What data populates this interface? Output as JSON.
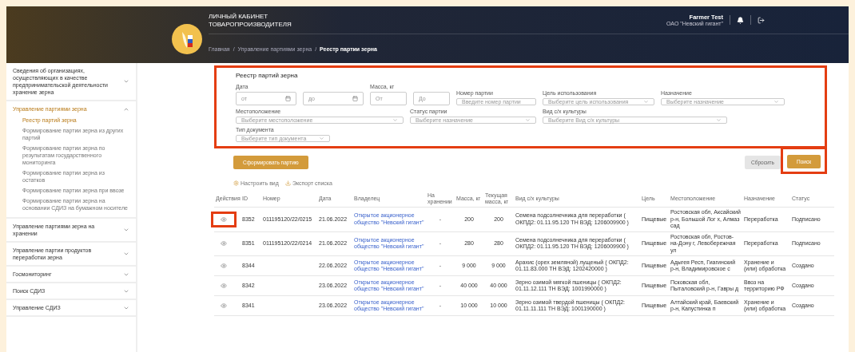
{
  "header": {
    "title_lines": [
      "ЛИЧНЫЙ КАБИНЕТ",
      "ТОВАРОПРОИЗВОДИТЕЛЯ"
    ],
    "breadcrumbs": [
      {
        "label": "Главная",
        "current": false
      },
      {
        "label": "Управление партиями зерна",
        "current": false
      },
      {
        "label": "Реестр партии зерна",
        "current": true
      }
    ],
    "breadcrumb_separator": "/",
    "user": {
      "name": "Farmer Test",
      "org": "ОАО \"Невский гигант\""
    }
  },
  "sidebar": {
    "items": [
      {
        "label": "Сведения об организациях, осуществляющих в качестве предпринимательской деятельности хранение зерна",
        "expanded": false
      },
      {
        "label": "Управление партиями зерна",
        "expanded": true,
        "children": [
          {
            "label": "Реестр партий зерна",
            "selected": true
          },
          {
            "label": "Формирование партии зерна из других партий",
            "selected": false
          },
          {
            "label": "Формирование партии зерна по результатам государственного мониторинга",
            "selected": false
          },
          {
            "label": "Формирование партии зерна из остатков",
            "selected": false
          },
          {
            "label": "Формирование партии зерна при ввозе",
            "selected": false
          },
          {
            "label": "Формирование партии зерна на основании СДИЗ на бумажном носителе",
            "selected": false
          }
        ]
      },
      {
        "label": "Управление партиями зерна на хранении",
        "expanded": false
      },
      {
        "label": "Управление партии продуктов переработки зерна",
        "expanded": false
      },
      {
        "label": "Госмониторинг",
        "expanded": false
      },
      {
        "label": "Поиск СДИЗ",
        "expanded": false
      },
      {
        "label": "Управление СДИЗ",
        "expanded": false
      }
    ]
  },
  "filters": {
    "title": "Реестр партий зерна",
    "highlighted": true,
    "fields": [
      {
        "kind": "date_range",
        "label": "Дата",
        "placeholders": [
          "от",
          "до"
        ]
      },
      {
        "kind": "range",
        "label": "Масса, кг",
        "placeholders": [
          "От",
          "До"
        ]
      },
      {
        "kind": "text",
        "label": "Номер партии",
        "placeholder": "Введите номер партии"
      },
      {
        "kind": "select",
        "label": "Цель использования",
        "placeholder": "Выберите цель использования"
      },
      {
        "kind": "select",
        "label": "Назначение",
        "placeholder": "Выберите назначение"
      },
      {
        "kind": "select",
        "label": "Местоположение",
        "placeholder": "Выберите местоположение"
      },
      {
        "kind": "select",
        "label": "Статус партии",
        "placeholder": "Выберите назначение"
      },
      {
        "kind": "select",
        "label": "Вид с/х культуры",
        "placeholder": "Выберите Вид с/х культуры"
      },
      {
        "kind": "select",
        "label": "Тип документа",
        "placeholder": "Выберите тип документа"
      }
    ]
  },
  "actions": {
    "create": {
      "label": "Сформировать партию"
    },
    "reset": {
      "label": "Сбросить",
      "disabled": true
    },
    "search": {
      "label": "Поиск",
      "highlighted": true
    }
  },
  "toolbar": [
    {
      "kind": "settings",
      "label": "Настроить вид"
    },
    {
      "kind": "export",
      "label": "Экспорт списка"
    }
  ],
  "table": {
    "columns": [
      "Действия",
      "ID",
      "Номер",
      "Дата",
      "Владелец",
      "На хранении",
      "Масса, кг",
      "Текущая масса, кг",
      "Вид с/х культуры",
      "Цель",
      "Местоположение",
      "Назначение",
      "Статус"
    ],
    "rows": [
      {
        "highlighted": true,
        "id": "8352",
        "number": "011195120/22/0215",
        "date": "21.06.2022",
        "owner": "Открытое акционерное общество \"Невский гигант\"",
        "storage": "-",
        "mass": "200",
        "current_mass": "200",
        "crop": "Семена подсолнечника для переработки ( ОКПД2: 01.11.95.120 ТН ВЭД: 1206009900 )",
        "purpose": "Пищевые",
        "location": "Ростовская обл, Аксайский р-н, Большой Лог х, Алмаз сад",
        "assignment": "Переработка",
        "status": "Подписано"
      },
      {
        "highlighted": false,
        "id": "8351",
        "number": "011195120/22/0214",
        "date": "21.06.2022",
        "owner": "Открытое акционерное общество \"Невский гигант\"",
        "storage": "-",
        "mass": "280",
        "current_mass": "280",
        "crop": "Семена подсолнечника для переработки ( ОКПД2: 01.11.95.120 ТН ВЭД: 1206009900 )",
        "purpose": "Пищевые",
        "location": "Ростовская обл, Ростов-на-Дону г, Левобережная ул",
        "assignment": "Переработка",
        "status": "Подписано"
      },
      {
        "highlighted": false,
        "id": "8344",
        "number": "",
        "date": "22.06.2022",
        "owner": "Открытое акционерное общество \"Невский гигант\"",
        "storage": "-",
        "mass": "9 000",
        "current_mass": "9 000",
        "crop": "Арахис (орех земляной) лущеный ( ОКПД2: 01.11.83.000 ТН ВЭД: 1202420000 )",
        "purpose": "Пищевые",
        "location": "Адыгея Респ, Гиагинский р-н, Владимировское с",
        "assignment": "Хранение и (или) обработка",
        "status": "Создано"
      },
      {
        "highlighted": false,
        "id": "8342",
        "number": "",
        "date": "23.06.2022",
        "owner": "Открытое акционерное общество \"Невский гигант\"",
        "storage": "-",
        "mass": "40 000",
        "current_mass": "40 000",
        "crop": "Зерно озимой мягкой пшеницы ( ОКПД2: 01.11.12.111 ТН ВЭД: 1001990000 )",
        "purpose": "Пищевые",
        "location": "Псковская обл, Пыталовский р-н, Гавры д",
        "assignment": "Ввоз на территорию РФ",
        "status": "Создано"
      },
      {
        "highlighted": false,
        "id": "8341",
        "number": "",
        "date": "23.06.2022",
        "owner": "Открытое акционерное общество \"Невский гигант\"",
        "storage": "-",
        "mass": "10 000",
        "current_mass": "10 000",
        "crop": "Зерно озимой твердой пшеницы ( ОКПД2: 01.11.11.111 ТН ВЭД: 1001190000 )",
        "purpose": "Пищевые",
        "location": "Алтайский край, Баевский р-н, Капустинка п",
        "assignment": "Хранение и (или) обработка",
        "status": "Создано"
      }
    ]
  }
}
